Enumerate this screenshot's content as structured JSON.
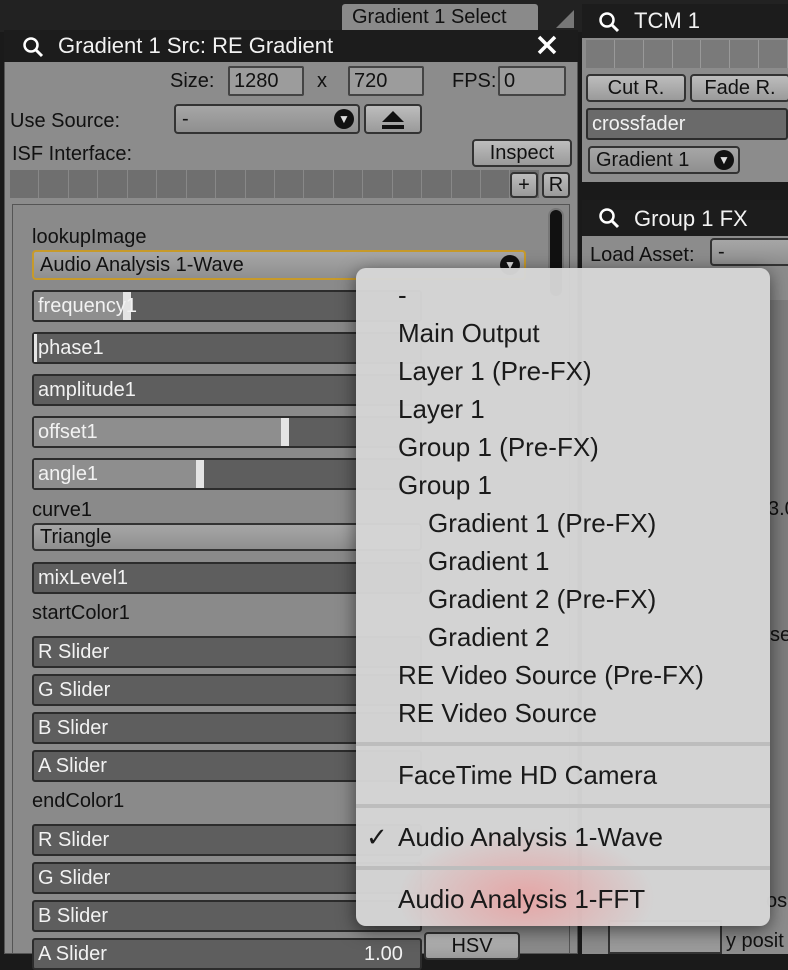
{
  "top_tab": "Gradient 1 Select",
  "main": {
    "title": "Gradient 1 Src: RE Gradient",
    "size_label": "Size:",
    "width": "1280",
    "x": "x",
    "height": "720",
    "fps_label": "FPS:",
    "fps": "0",
    "use_source_label": "Use Source:",
    "use_source_value": "-",
    "isf_label": "ISF Interface:",
    "inspect": "Inspect",
    "plus": "+",
    "r": "R",
    "lookup_label": "lookupImage",
    "lookup_value": "Audio Analysis 1-Wave",
    "sliders": {
      "frequency1": "frequency1",
      "phase1": "phase1",
      "amplitude1": "amplitude1",
      "offset1": "offset1",
      "angle1": "angle1",
      "mixLevel1": "mixLevel1"
    },
    "curve_label": "curve1",
    "curve_value": "Triangle",
    "start_label": "startColor1",
    "end_label": "endColor1",
    "r_slider": "R Slider",
    "g_slider": "G Slider",
    "b_slider": "B Slider",
    "a_slider": "A Slider",
    "a_value": "1.00",
    "hsv": "HSV",
    "slider_levels": {
      "frequency1": 0.24,
      "offset1": 0.65,
      "angle1": 0.43,
      "phase1": 0.0
    }
  },
  "right": {
    "tcm_title": "TCM 1",
    "cut_button": "Cut R.",
    "fade_button": "Fade R.",
    "crossfader": "crossfader",
    "target": "Gradient 1",
    "group_title": "Group 1 FX",
    "load_asset_label": "Load Asset:",
    "load_asset_value": "-",
    "partial_value": "3.0",
    "partial_se": "se",
    "partial_posit": "osit",
    "partial_y_posit": "y posit"
  },
  "menu": {
    "items": [
      {
        "label": "-",
        "indent": 0
      },
      {
        "label": "Main Output",
        "indent": 0
      },
      {
        "label": "Layer 1 (Pre-FX)",
        "indent": 0
      },
      {
        "label": "Layer 1",
        "indent": 0
      },
      {
        "label": "Group 1 (Pre-FX)",
        "indent": 0
      },
      {
        "label": "Group 1",
        "indent": 0
      },
      {
        "label": "Gradient 1 (Pre-FX)",
        "indent": 1
      },
      {
        "label": "Gradient 1",
        "indent": 1
      },
      {
        "label": "Gradient 2 (Pre-FX)",
        "indent": 1
      },
      {
        "label": "Gradient 2",
        "indent": 1
      },
      {
        "label": "RE Video Source (Pre-FX)",
        "indent": 0
      },
      {
        "label": "RE Video Source",
        "indent": 0
      }
    ],
    "camera": "FaceTime HD Camera",
    "checkmark": "✓",
    "selected": "Audio Analysis 1-Wave",
    "fft": "Audio Analysis 1-FFT"
  }
}
